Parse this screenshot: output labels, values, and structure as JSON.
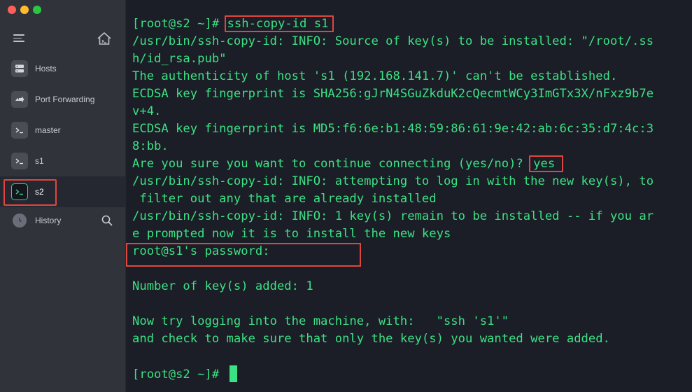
{
  "window": {
    "traffic_lights": [
      {
        "name": "close-button",
        "color": "#fd5f57"
      },
      {
        "name": "minimize-button",
        "color": "#febc2e"
      },
      {
        "name": "zoom-button",
        "color": "#28c840"
      }
    ]
  },
  "sidebar": {
    "items": [
      {
        "label": "Hosts",
        "icon": "server-icon"
      },
      {
        "label": "Port Forwarding",
        "icon": "port-forwarding-icon"
      },
      {
        "label": "master",
        "icon": "terminal-icon"
      },
      {
        "label": "s1",
        "icon": "terminal-icon"
      },
      {
        "label": "s2",
        "icon": "terminal-icon",
        "active": true
      },
      {
        "label": "History",
        "icon": "clock-icon"
      }
    ]
  },
  "terminal": {
    "lines": [
      {
        "prompt": "[root@s2 ~]# ",
        "command": "ssh-copy-id s1"
      },
      {
        "text": "/usr/bin/ssh-copy-id: INFO: Source of key(s) to be installed: \"/root/.ss"
      },
      {
        "text": "h/id_rsa.pub\""
      },
      {
        "text": "The authenticity of host 's1 (192.168.141.7)' can't be established."
      },
      {
        "text": "ECDSA key fingerprint is SHA256:gJrN4SGuZkduK2cQecmtWCy3ImGTx3X/nFxz9b7e"
      },
      {
        "text": "v+4."
      },
      {
        "text": "ECDSA key fingerprint is MD5:f6:6e:b1:48:59:86:61:9e:42:ab:6c:35:d7:4c:3"
      },
      {
        "text": "8:bb."
      },
      {
        "text": "Are you sure you want to continue connecting (yes/no)? ",
        "answer": "yes"
      },
      {
        "text": "/usr/bin/ssh-copy-id: INFO: attempting to log in with the new key(s), to"
      },
      {
        "text": " filter out any that are already installed"
      },
      {
        "text": "/usr/bin/ssh-copy-id: INFO: 1 key(s) remain to be installed -- if you ar"
      },
      {
        "text": "e prompted now it is to install the new keys"
      },
      {
        "text": "root@s1's password:"
      },
      {
        "text": ""
      },
      {
        "text": "Number of key(s) added: 1"
      },
      {
        "text": ""
      },
      {
        "text": "Now try logging into the machine, with:   \"ssh 's1'\""
      },
      {
        "text": "and check to make sure that only the key(s) you wanted were added."
      },
      {
        "text": ""
      },
      {
        "prompt": "[root@s2 ~]# "
      }
    ],
    "text_color": "#3be283",
    "background": "#1b1d27",
    "highlight_color": "#e0463e"
  }
}
